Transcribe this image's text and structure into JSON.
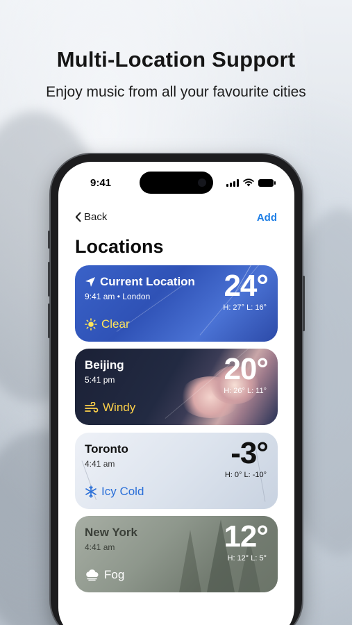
{
  "promo": {
    "headline": "Multi-Location Support",
    "subheadline": "Enjoy music from all your favourite cities"
  },
  "status_bar": {
    "time": "9:41"
  },
  "nav": {
    "back_label": "Back",
    "add_label": "Add"
  },
  "page_title": "Locations",
  "locations": [
    {
      "name": "Current Location",
      "subtitle": "9:41 am • London",
      "temp": "24°",
      "hi_lo": "H: 27°  L: 16°",
      "condition": "Clear",
      "icon": "sun-icon"
    },
    {
      "name": "Beijing",
      "subtitle": "5:41 pm",
      "temp": "20°",
      "hi_lo": "H: 26°  L: 11°",
      "condition": "Windy",
      "icon": "wind-icon"
    },
    {
      "name": "Toronto",
      "subtitle": "4:41 am",
      "temp": "-3°",
      "hi_lo": "H: 0°  L: -10°",
      "condition": "Icy Cold",
      "icon": "snowflake-icon"
    },
    {
      "name": "New York",
      "subtitle": "4:41 am",
      "temp": "12°",
      "hi_lo": "H: 12°  L: 5°",
      "condition": "Fog",
      "icon": "cloud-icon"
    }
  ],
  "colors": {
    "accent": "#1f7fe6",
    "clear_yellow": "#ffe45a",
    "windy_yellow": "#ffd24a",
    "icy_blue": "#2a6fd8"
  }
}
